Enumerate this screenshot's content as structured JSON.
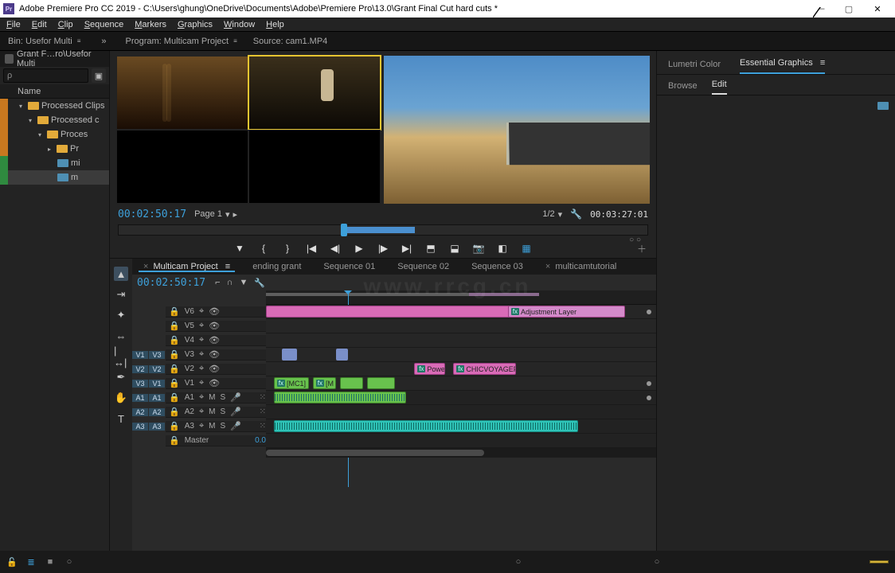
{
  "app": {
    "title_prefix": "Adobe Premiere Pro CC 2019 - ",
    "project_path": "C:\\Users\\ghung\\OneDrive\\Documents\\Adobe\\Premiere Pro\\13.0\\Grant Final Cut hard cuts *",
    "icon_label": "Pr"
  },
  "menu": [
    "File",
    "Edit",
    "Clip",
    "Sequence",
    "Markers",
    "Graphics",
    "Window",
    "Help"
  ],
  "panel_tabs": {
    "bin": "Bin: Usefor Multi",
    "program": "Program: Multicam Project",
    "source": "Source: cam1.MP4"
  },
  "project_panel": {
    "breadcrumb": "Grant F…ro\\Usefor Multi",
    "search_placeholder": "ρ",
    "header": "Name",
    "tree": [
      {
        "label": "Processed Clips",
        "swatch": "orange",
        "icon": "folder",
        "indent": 1
      },
      {
        "label": "Processed c",
        "swatch": "orange",
        "icon": "folder",
        "indent": 2
      },
      {
        "label": "Proces",
        "swatch": "orange",
        "icon": "folder",
        "indent": 3
      },
      {
        "label": "Pr",
        "swatch": "orange",
        "icon": "folder",
        "indent": 4,
        "leaf": true
      },
      {
        "label": "mi",
        "swatch": "green",
        "icon": "clip",
        "indent": 4,
        "leaf": true
      },
      {
        "label": "m",
        "swatch": "green",
        "icon": "clip",
        "indent": 4,
        "leaf": true,
        "sel": true
      }
    ]
  },
  "program_monitor": {
    "timecode": "00:02:50:17",
    "page_label": "Page 1",
    "scale_label": "1/2",
    "duration": "00:03:27:01"
  },
  "transport": {
    "buttons": [
      "marker",
      "in",
      "out",
      "goto-in",
      "step-back",
      "play",
      "step-fwd",
      "goto-out",
      "lift",
      "extract",
      "snapshot",
      "comp",
      "en"
    ]
  },
  "sequence_tabs": [
    {
      "label": "Multicam Project",
      "active": true,
      "close": true
    },
    {
      "label": "ending grant"
    },
    {
      "label": "Sequence 01"
    },
    {
      "label": "Sequence 02"
    },
    {
      "label": "Sequence 03"
    },
    {
      "label": "multicamtutorial",
      "close": true
    }
  ],
  "timeline": {
    "timecode": "00:02:50:17",
    "video_tracks": [
      {
        "name": "V6",
        "adj": "Adjustment Layer"
      },
      {
        "name": "V5"
      },
      {
        "name": "V4"
      },
      {
        "name": "V3"
      },
      {
        "name": "V2"
      },
      {
        "name": "V1",
        "mc": "[MC1]",
        "m": "[M",
        "pow": "Powerf",
        "chic": "CHICVOYAGEP"
      }
    ],
    "audio_tracks": [
      {
        "name": "A1"
      },
      {
        "name": "A2"
      },
      {
        "name": "A3"
      }
    ],
    "master": {
      "label": "Master",
      "val": "0.0"
    }
  },
  "right_panel": {
    "tabs": [
      "Lumetri Color",
      "Essential Graphics"
    ],
    "subtabs": [
      "Browse",
      "Edit"
    ]
  },
  "watermark_url": "www.rrcg.cn"
}
